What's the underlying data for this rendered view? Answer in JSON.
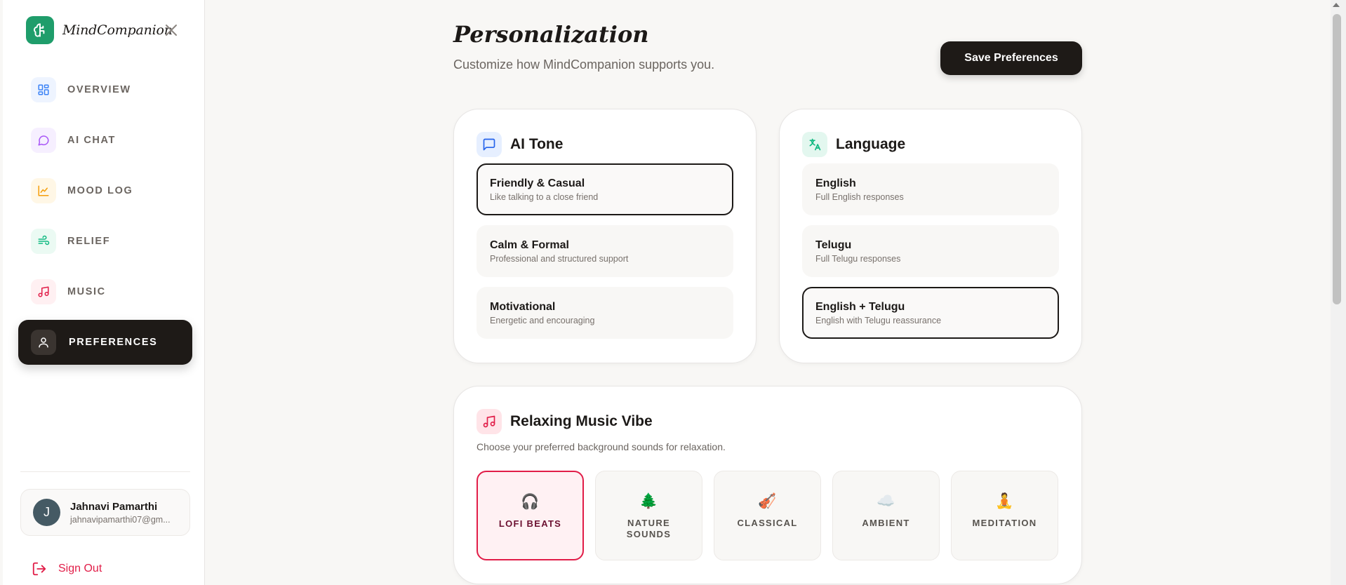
{
  "brand": {
    "name": "MindCompanion"
  },
  "sidebar": {
    "items": [
      {
        "label": "OVERVIEW",
        "icon": "grid-icon",
        "color": "#3b82f6",
        "bg": "#eef4ff"
      },
      {
        "label": "AI CHAT",
        "icon": "chat-bubble-icon",
        "color": "#a855f7",
        "bg": "#f6efff"
      },
      {
        "label": "MOOD LOG",
        "icon": "line-chart-icon",
        "color": "#f59e0b",
        "bg": "#fff7e6"
      },
      {
        "label": "RELIEF",
        "icon": "wind-icon",
        "color": "#10b981",
        "bg": "#ebfaf3"
      },
      {
        "label": "MUSIC",
        "icon": "music-note-icon",
        "color": "#e11d48",
        "bg": "#fff0f2"
      },
      {
        "label": "PREFERENCES",
        "icon": "user-icon",
        "active": true
      }
    ],
    "user": {
      "initial": "J",
      "name": "Jahnavi Pamarthi",
      "email": "jahnavipamarthi07@gm..."
    },
    "signout_label": "Sign Out"
  },
  "header": {
    "title": "Personalization",
    "subtitle": "Customize how MindCompanion supports you.",
    "save_label": "Save Preferences"
  },
  "tone": {
    "title": "AI Tone",
    "options": [
      {
        "title": "Friendly & Casual",
        "sub": "Like talking to a close friend",
        "selected": true
      },
      {
        "title": "Calm & Formal",
        "sub": "Professional and structured support",
        "selected": false
      },
      {
        "title": "Motivational",
        "sub": "Energetic and encouraging",
        "selected": false
      }
    ]
  },
  "language": {
    "title": "Language",
    "options": [
      {
        "title": "English",
        "sub": "Full English responses",
        "selected": false
      },
      {
        "title": "Telugu",
        "sub": "Full Telugu responses",
        "selected": false
      },
      {
        "title": "English + Telugu",
        "sub": "English with Telugu reassurance",
        "selected": true
      }
    ]
  },
  "music": {
    "title": "Relaxing Music Vibe",
    "description": "Choose your preferred background sounds for relaxation.",
    "vibes": [
      {
        "emoji": "🎧",
        "label": "LOFI BEATS",
        "selected": true
      },
      {
        "emoji": "🌲",
        "label": "NATURE SOUNDS",
        "selected": false
      },
      {
        "emoji": "🎻",
        "label": "CLASSICAL",
        "selected": false
      },
      {
        "emoji": "☁️",
        "label": "AMBIENT",
        "selected": false
      },
      {
        "emoji": "🧘",
        "label": "MEDITATION",
        "selected": false
      }
    ]
  },
  "colors": {
    "accent": "#e11d48",
    "dark": "#1e1a17",
    "brand": "#1f9d6b"
  }
}
